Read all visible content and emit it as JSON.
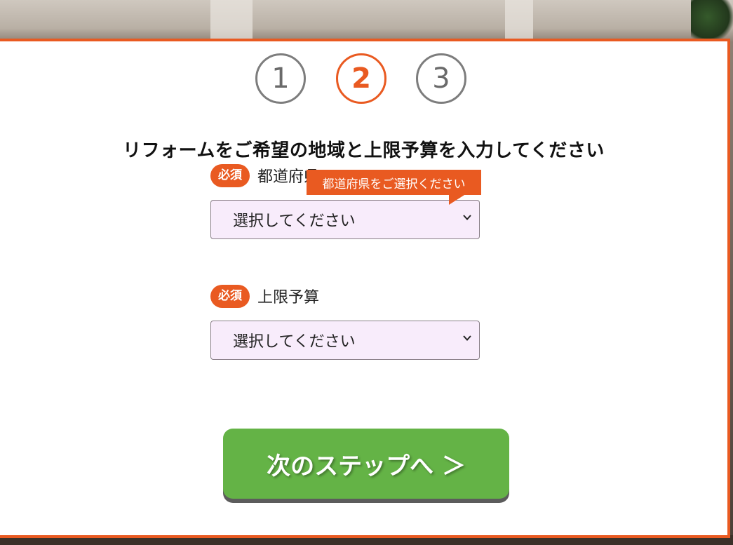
{
  "steps": [
    {
      "label": "1",
      "active": false
    },
    {
      "label": "2",
      "active": true
    },
    {
      "label": "3",
      "active": false
    }
  ],
  "heading": "リフォームをご希望の地域と上限予算を入力してください",
  "fields": {
    "prefecture": {
      "required_label": "必須",
      "label": "都道府県",
      "select_value": "選択してください",
      "tooltip": "都道府県をご選択ください"
    },
    "budget": {
      "required_label": "必須",
      "label": "上限予算",
      "select_value": "選択してください"
    }
  },
  "next_button": {
    "label": "次のステップへ ＞"
  },
  "colors": {
    "accent": "#e95a21",
    "button": "#64b346",
    "select_bg": "#f8ecfb",
    "step_inactive": "#7d7d7d"
  }
}
